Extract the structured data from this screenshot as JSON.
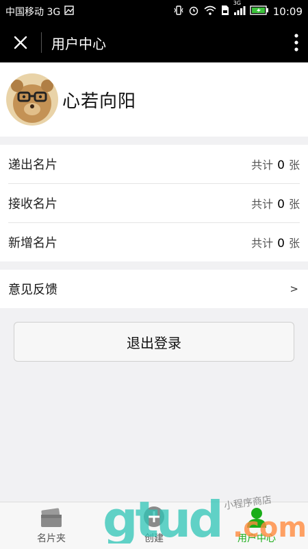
{
  "status_bar": {
    "carrier": "中国移动 3G",
    "network": "3G",
    "time": "10:09"
  },
  "nav": {
    "title": "用户中心"
  },
  "profile": {
    "name": "心若向阳"
  },
  "cards": [
    {
      "label": "递出名片",
      "prefix": "共计",
      "count": "0",
      "unit": "张"
    },
    {
      "label": "接收名片",
      "prefix": "共计",
      "count": "0",
      "unit": "张"
    },
    {
      "label": "新增名片",
      "prefix": "共计",
      "count": "0",
      "unit": "张"
    }
  ],
  "feedback": {
    "label": "意见反馈",
    "chevron": ">"
  },
  "logout": {
    "label": "退出登录"
  },
  "tabs": [
    {
      "label": "名片夹",
      "icon": "card-holder-icon"
    },
    {
      "label": "创建",
      "icon": "plus-circle-icon"
    },
    {
      "label": "用户中心",
      "icon": "user-icon"
    }
  ],
  "watermark": {
    "text": "gtud.com",
    "subtext": "小程序商店"
  },
  "colors": {
    "accent": "#1aad19",
    "nav_bg": "#000000",
    "page_bg": "#f1f1f3"
  }
}
